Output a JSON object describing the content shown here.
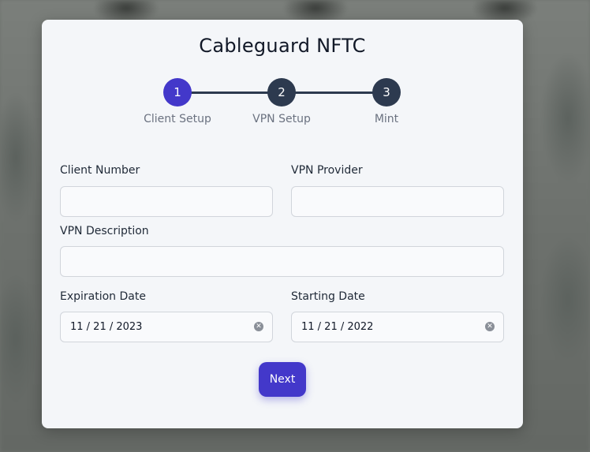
{
  "app": {
    "title": "Cableguard NFTC"
  },
  "stepper": {
    "steps": [
      {
        "number": "1",
        "label": "Client Setup",
        "state": "active"
      },
      {
        "number": "2",
        "label": "VPN Setup",
        "state": "pending"
      },
      {
        "number": "3",
        "label": "Mint",
        "state": "pending"
      }
    ]
  },
  "form": {
    "client_number": {
      "label": "Client Number",
      "value": "",
      "placeholder": ""
    },
    "vpn_provider": {
      "label": "VPN Provider",
      "value": "",
      "placeholder": ""
    },
    "vpn_description": {
      "label": "VPN Description",
      "value": "",
      "placeholder": ""
    },
    "expiration_date": {
      "label": "Expiration Date",
      "value": "11 / 21 / 2023"
    },
    "starting_date": {
      "label": "Starting Date",
      "value": "11 / 21 / 2022"
    }
  },
  "actions": {
    "next_label": "Next"
  },
  "colors": {
    "accent": "#4338ca",
    "step_pending": "#2d3a4f",
    "card_bg": "#f4f6f9"
  }
}
